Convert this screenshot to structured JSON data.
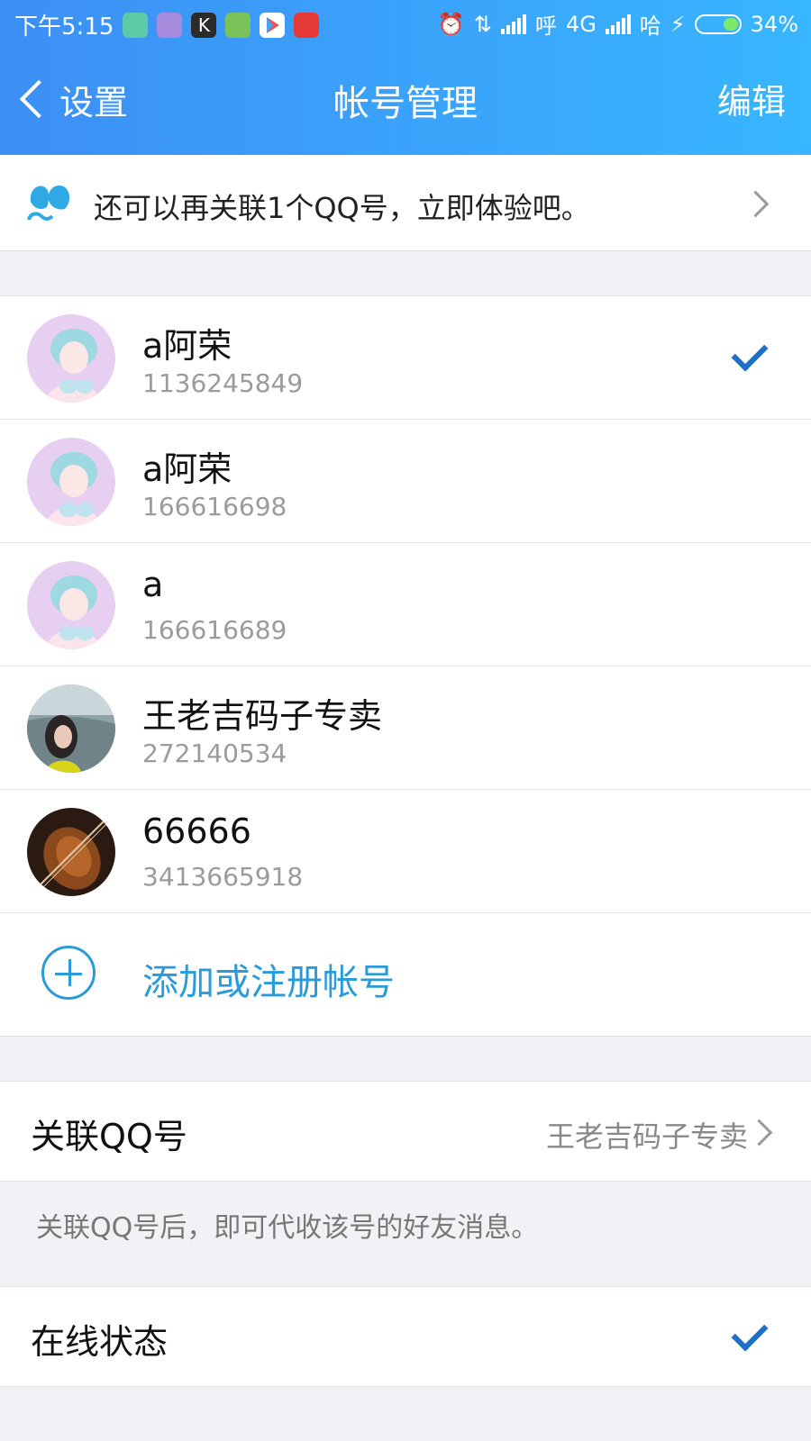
{
  "status_bar": {
    "time": "下午5:15",
    "carrier_1": "呼",
    "network": "4G",
    "carrier_2": "哈",
    "battery": "34%",
    "app_icons": [
      "clock-app-icon",
      "purple-app-icon",
      "k-app-icon",
      "battery-app-icon",
      "play-store-icon",
      "red-app-icon"
    ],
    "accent_battery": "#7ee86b"
  },
  "nav": {
    "back_label": "设置",
    "title": "帐号管理",
    "edit_label": "编辑"
  },
  "promo": {
    "text": "还可以再关联1个QQ号，立即体验吧。",
    "icon": "people-icon"
  },
  "accounts": [
    {
      "name": "a阿荣",
      "id": "1136245849",
      "selected": true
    },
    {
      "name": "a阿荣",
      "id": "166616698",
      "selected": false
    },
    {
      "name": "a",
      "id": "166616689",
      "selected": false
    },
    {
      "name": "王老吉码子专卖",
      "id": "272140534",
      "selected": false
    },
    {
      "name": "66666",
      "id": "3413665918",
      "selected": false
    }
  ],
  "add_account": {
    "label": "添加或注册帐号"
  },
  "linked_qq": {
    "label": "关联QQ号",
    "value": "王老吉码子专卖",
    "note": "关联QQ号后，即可代收该号的好友消息。"
  },
  "online_status": {
    "label": "在线状态",
    "enabled": true
  },
  "colors": {
    "header_gradient_start": "#3c8ff4",
    "header_gradient_end": "#38b6ff",
    "accent_link": "#2a9bd8",
    "check_blue": "#1e6fc8"
  }
}
